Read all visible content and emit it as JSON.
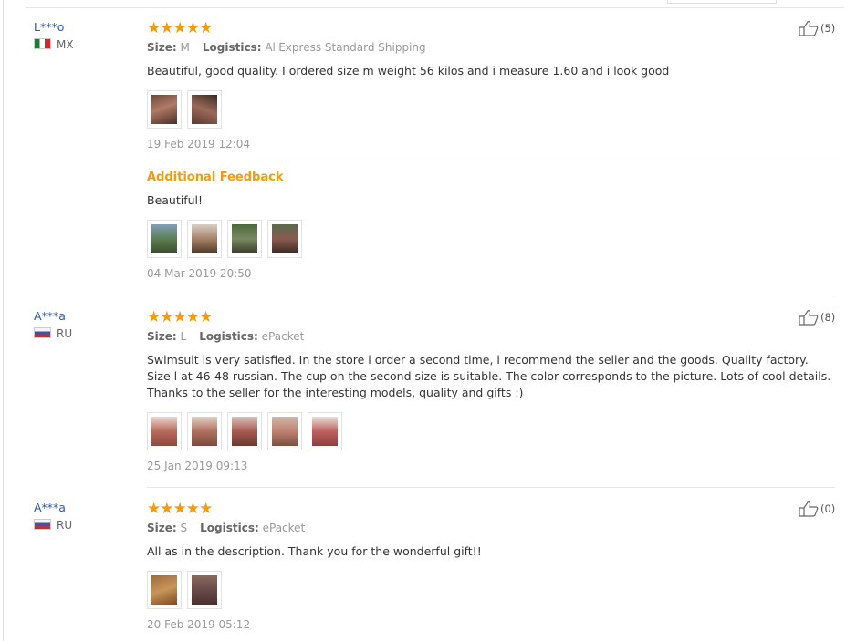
{
  "labels": {
    "size": "Size:",
    "logistics": "Logistics:",
    "additional": "Additional Feedback"
  },
  "colors": {
    "star": "#f59a0c",
    "username": "#2f57a8",
    "accent": "#f59a0c"
  },
  "reviews": [
    {
      "user": "L***o",
      "country": "MX",
      "flag": "mexico-flag-icon",
      "stars": "★★★★★",
      "rating": 5,
      "size": "M",
      "logistics": "AliExpress Standard Shipping",
      "text": "Beautiful, good quality. I ordered size m weight 56 kilos and i measure 1.60 and i look good",
      "photos": 2,
      "date": "19 Feb 2019 12:04",
      "helpful": "(5)",
      "additional": {
        "text": "Beautiful!",
        "photos": 4,
        "date": "04 Mar 2019 20:50"
      }
    },
    {
      "user": "A***a",
      "country": "RU",
      "flag": "russia-flag-icon",
      "stars": "★★★★★",
      "rating": 5,
      "size": "L",
      "logistics": "ePacket",
      "text": "Swimsuit is very satisfied. In the store i order a second time, i recommend the seller and the goods. Quality factory. Size l at 46-48 russian. The cup on the second size is suitable. The color corresponds to the picture. Lots of cool details. Thanks to the seller for the interesting models, quality and gifts :)",
      "photos": 5,
      "date": "25 Jan 2019 09:13",
      "helpful": "(8)"
    },
    {
      "user": "A***a",
      "country": "RU",
      "flag": "russia-flag-icon",
      "stars": "★★★★★",
      "rating": 5,
      "size": "S",
      "logistics": "ePacket",
      "text": "All as in the description. Thank you for the wonderful gift!!",
      "photos": 2,
      "date": "20 Feb 2019 05:12",
      "helpful": "(0)"
    }
  ]
}
